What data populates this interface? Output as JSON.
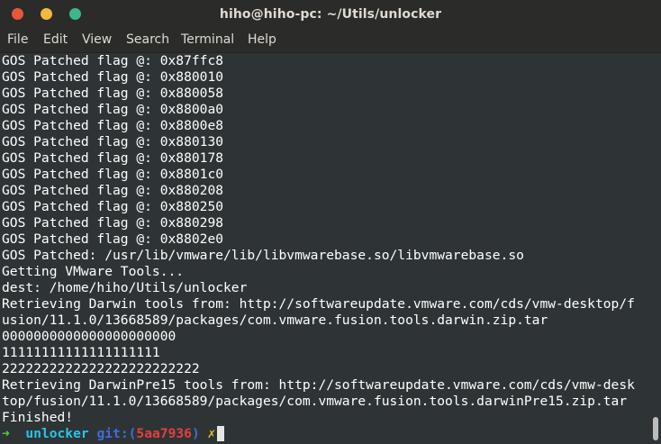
{
  "window": {
    "title": "hiho@hiho-pc: ~/Utils/unlocker"
  },
  "menu": [
    "File",
    "Edit",
    "View",
    "Search",
    "Terminal",
    "Help"
  ],
  "terminal": {
    "lines": [
      "GOS Patched flag @: 0x87ffc8",
      "GOS Patched flag @: 0x880010",
      "GOS Patched flag @: 0x880058",
      "GOS Patched flag @: 0x8800a0",
      "GOS Patched flag @: 0x8800e8",
      "GOS Patched flag @: 0x880130",
      "GOS Patched flag @: 0x880178",
      "GOS Patched flag @: 0x8801c0",
      "GOS Patched flag @: 0x880208",
      "GOS Patched flag @: 0x880250",
      "GOS Patched flag @: 0x880298",
      "GOS Patched flag @: 0x8802e0",
      "GOS Patched: /usr/lib/vmware/lib/libvmwarebase.so/libvmwarebase.so",
      "Getting VMware Tools...",
      "dest: /home/hiho/Utils/unlocker",
      "Retrieving Darwin tools from: http://softwareupdate.vmware.com/cds/vmw-desktop/f",
      "usion/11.1.0/13668589/packages/com.vmware.fusion.tools.darwin.zip.tar",
      "0000000000000000000000",
      "11111111111111111111",
      "2222222222222222222222222",
      "Retrieving DarwinPre15 tools from: http://softwareupdate.vmware.com/cds/vmw-desk",
      "top/fusion/11.1.0/13668589/packages/com.vmware.fusion.tools.darwinPre15.zip.tar",
      "Finished!"
    ],
    "prompt": {
      "arrow": "➜",
      "dir": "unlocker",
      "git_label": "git:",
      "paren_open": "(",
      "branch": "5aa7936",
      "paren_close": ")",
      "dirty_mark": "✗"
    }
  }
}
